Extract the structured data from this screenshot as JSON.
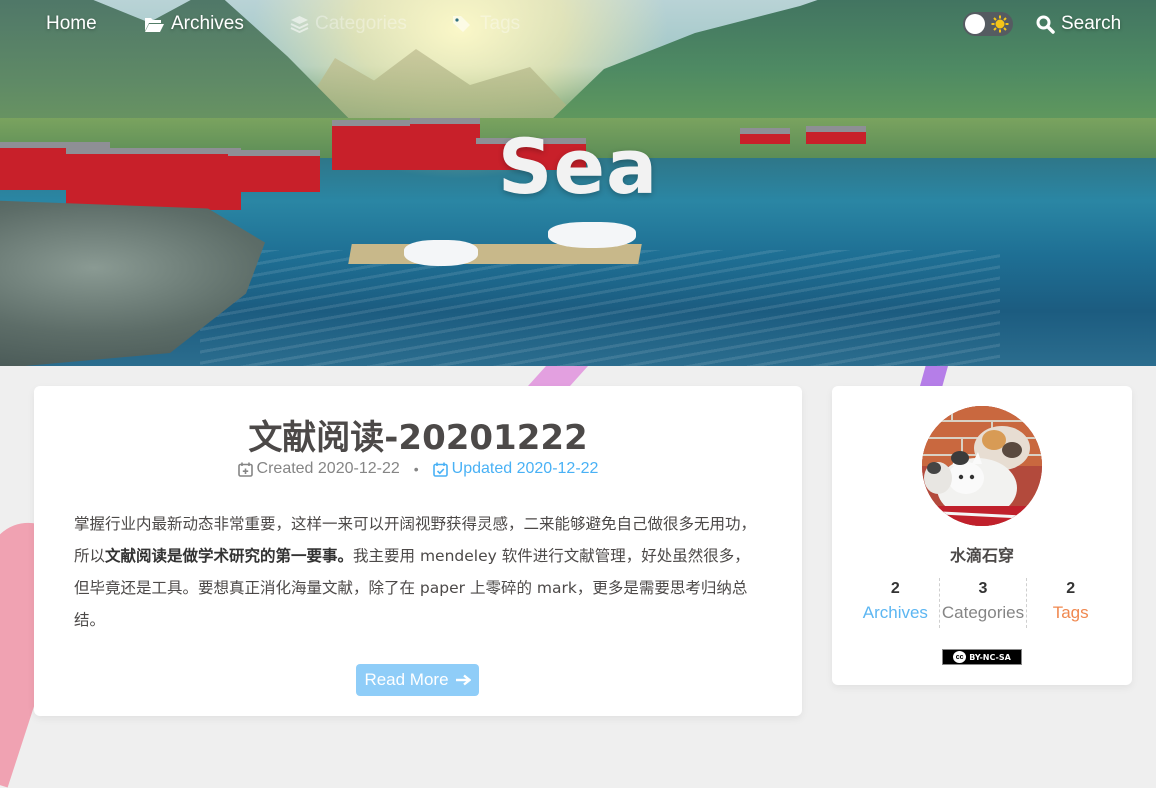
{
  "nav": {
    "home": "Home",
    "archives": "Archives",
    "categories": "Categories",
    "tags": "Tags",
    "search": "Search"
  },
  "hero": {
    "title": "Sea"
  },
  "post": {
    "title": "文献阅读-20201222",
    "created_label": "Created",
    "created_date": "2020-12-22",
    "separator": "•",
    "updated_label": "Updated",
    "updated_date": "2020-12-22",
    "excerpt_part1": "掌握行业内最新动态非常重要，这样一来可以开阔视野获得灵感，二来能够避免自己做很多无用功，所以",
    "excerpt_bold": "文献阅读是做学术研究的第一要事。",
    "excerpt_part2": "我主要用 mendeley 软件进行文献管理，好处虽然很多，但毕竟还是工具。要想真正消化海量文献，除了在 paper 上零碎的 mark，更多是需要思考归纳总结。",
    "read_more": "Read More"
  },
  "author": {
    "name": "水滴石穿",
    "stats": [
      {
        "num": "2",
        "label": "Archives",
        "color": "#5cb6f2"
      },
      {
        "num": "3",
        "label": "Categories",
        "color": "#858585"
      },
      {
        "num": "2",
        "label": "Tags",
        "color": "#f0884f"
      }
    ],
    "license": "BY-NC-SA",
    "license_cc": "cc"
  },
  "icons": {
    "archives": "folder-open-icon",
    "categories": "layers-icon",
    "tags": "tags-icon",
    "search": "search-icon",
    "created": "calendar-plus-icon",
    "updated": "calendar-check-icon",
    "read_more": "arrow-right-icon",
    "theme_toggle": "sun-icon"
  },
  "colors": {
    "accent": "#49b1f5",
    "read_more_bg": "#8fcdf8",
    "text": "#4c4948",
    "page_bg": "#efefef"
  }
}
